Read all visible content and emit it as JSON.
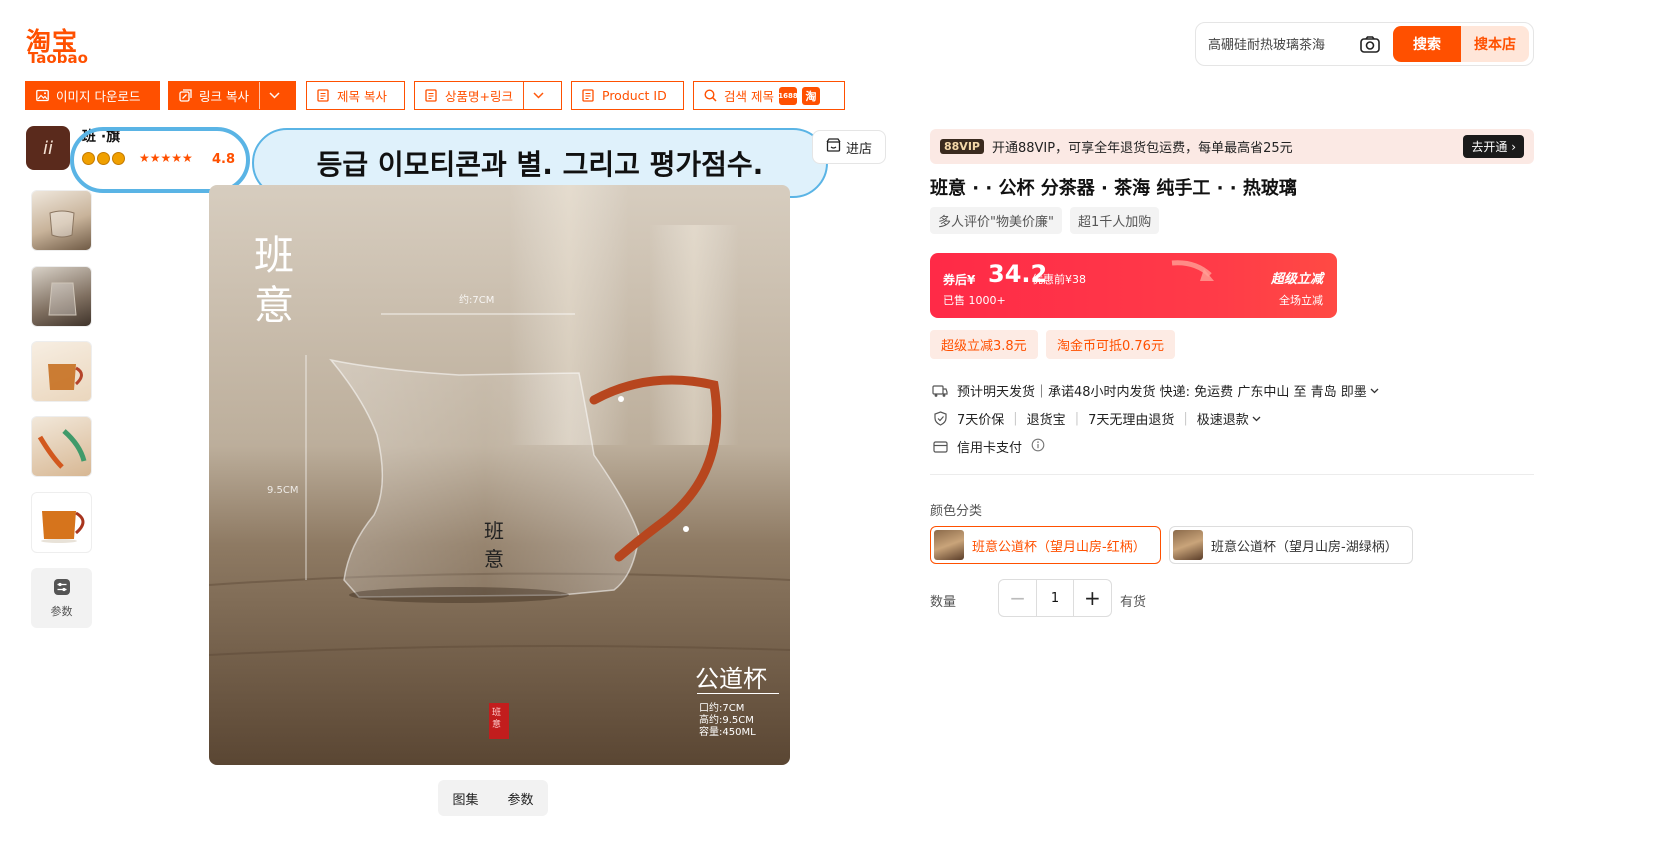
{
  "header": {
    "logo_cn": "淘宝",
    "logo_en": "Taobao",
    "search_placeholder": "高硼硅耐热玻璃茶海",
    "search_button": "搜索",
    "shop_search_button": "搜本店"
  },
  "toolbar": {
    "image_download": "이미지 다운로드",
    "link_copy": "링크 복사",
    "title_copy": "제목 복사",
    "product_name_link": "상품명+링크",
    "product_id": "Product ID",
    "search_title": "검색 제목",
    "badge_1688": "1688"
  },
  "store": {
    "avatar_text": "ii",
    "name": "班   ·旗",
    "rating_icons": "crown",
    "stars": "★★★★★",
    "score": "4.8",
    "enter_shop": "进店"
  },
  "annotation": {
    "callout": "등급 이모티콘과 별. 그리고 평가점수."
  },
  "gallery": {
    "param_label": "参数",
    "tab_gallery": "图集",
    "tab_params": "参数",
    "image_text": {
      "brand_line1": "班",
      "brand_line2": "意",
      "width": "约:7CM",
      "height": "9.5CM",
      "glass_mark_1": "班",
      "glass_mark_2": "意",
      "product_type": "公道杯",
      "spec_1": "口约:7CM",
      "spec_2": "高约:9.5CM",
      "spec_3": "容量:450ML",
      "seal": "班意"
    }
  },
  "product": {
    "vip_tag": "88VIP",
    "vip_text": "开通88VIP，可享全年退货包运费，每单最高省25元",
    "vip_button": "去开通 ›",
    "title": "班意  ·  · 公杯 分茶器   ·  茶海 纯手工  ·  · 热玻璃",
    "tags": [
      "多人评价\"物美价廉\"",
      "超1千人加购"
    ],
    "price": {
      "label": "券后¥",
      "value": "34.2",
      "before": "优惠前¥38",
      "sold": "已售 1000+",
      "promo_title": "超级立减",
      "promo_sub": "全场立减"
    },
    "promos": [
      "超级立减3.8元",
      "淘金币可抵0.76元"
    ],
    "shipping": "预计明天发货｜承诺48小时内发货  快递: 免运费  广东中山 至 青岛 即墨",
    "guarantees": [
      "7天价保",
      "退货宝",
      "7天无理由退货",
      "极速退款"
    ],
    "payment": "信用卡支付",
    "color_label": "颜色分类",
    "skus": [
      "班意公道杯（望月山房-红柄）",
      "班意公道杯（望月山房-湖绿柄）"
    ],
    "qty_label": "数量",
    "qty": "1",
    "stock": "有货"
  },
  "colors": {
    "brand": "#ff5000",
    "price_red": "#ff2a47",
    "callout_border": "#5ab4e5"
  }
}
